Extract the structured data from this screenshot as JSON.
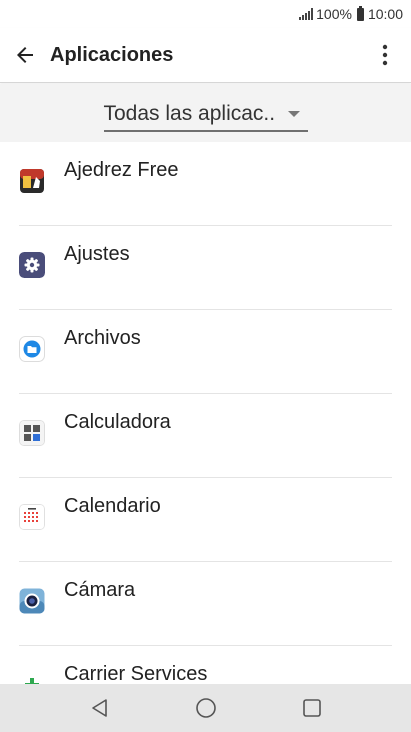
{
  "status_bar": {
    "battery": "100%",
    "time": "10:00"
  },
  "app_bar": {
    "title": "Aplicaciones"
  },
  "filter": {
    "selected": "Todas las aplicac.."
  },
  "apps": [
    {
      "name": "Ajedrez Free"
    },
    {
      "name": "Ajustes"
    },
    {
      "name": "Archivos"
    },
    {
      "name": "Calculadora"
    },
    {
      "name": "Calendario"
    },
    {
      "name": "Cámara"
    },
    {
      "name": "Carrier Services"
    }
  ],
  "colors": {
    "accent": "#e8413a",
    "settings": "#4a4d7a",
    "files": "#1e88e5"
  }
}
